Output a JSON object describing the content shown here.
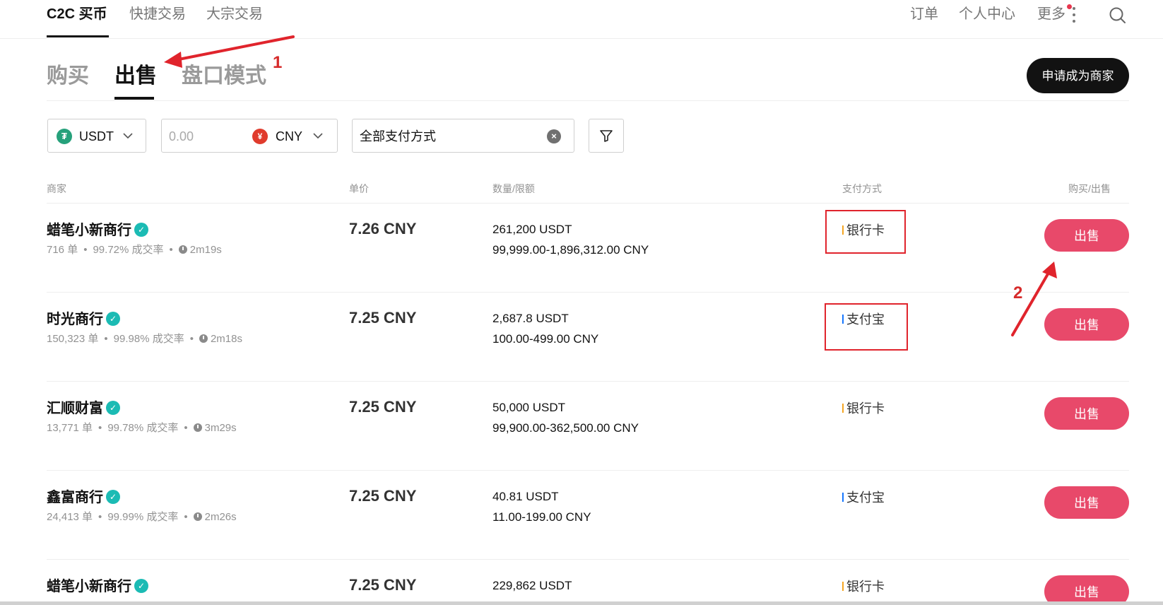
{
  "nav": {
    "items": [
      "C2C 买币",
      "快捷交易",
      "大宗交易"
    ],
    "right": [
      "订单",
      "个人中心",
      "更多"
    ]
  },
  "tabs": [
    "购买",
    "出售",
    "盘口模式"
  ],
  "merchant_button": "申请成为商家",
  "filters": {
    "coin": "USDT",
    "amount_placeholder": "0.00",
    "fiat": "CNY",
    "payment": "全部支付方式"
  },
  "table": {
    "headers": [
      "商家",
      "单价",
      "数量/限额",
      "支付方式",
      "购买/出售"
    ],
    "rows": [
      {
        "name": "蜡笔小新商行",
        "orders": "716 单",
        "rate": "99.72% 成交率",
        "time": "2m19s",
        "price": "7.26 CNY",
        "qty": "261,200 USDT",
        "limit": "99,999.00-1,896,312.00 CNY",
        "pay": "银行卡",
        "pay_color": "#f5a623",
        "action": "出售"
      },
      {
        "name": "时光商行",
        "orders": "150,323 单",
        "rate": "99.98% 成交率",
        "time": "2m18s",
        "price": "7.25 CNY",
        "qty": "2,687.8 USDT",
        "limit": "100.00-499.00 CNY",
        "pay": "支付宝",
        "pay_color": "#1677ff",
        "action": "出售"
      },
      {
        "name": "汇顺财富",
        "orders": "13,771 单",
        "rate": "99.78% 成交率",
        "time": "3m29s",
        "price": "7.25 CNY",
        "qty": "50,000 USDT",
        "limit": "99,900.00-362,500.00 CNY",
        "pay": "银行卡",
        "pay_color": "#f5a623",
        "action": "出售"
      },
      {
        "name": "鑫富商行",
        "orders": "24,413 单",
        "rate": "99.99% 成交率",
        "time": "2m26s",
        "price": "7.25 CNY",
        "qty": "40.81 USDT",
        "limit": "11.00-199.00 CNY",
        "pay": "支付宝",
        "pay_color": "#1677ff",
        "action": "出售"
      },
      {
        "name": "蜡笔小新商行",
        "orders": "",
        "rate": "",
        "time": "",
        "price": "7.25 CNY",
        "qty": "229,862 USDT",
        "limit": "",
        "pay": "银行卡",
        "pay_color": "#f5a623",
        "action": "出售"
      }
    ]
  },
  "annotations": {
    "step1": "1",
    "step2": "2",
    "color": "#e0242c"
  }
}
